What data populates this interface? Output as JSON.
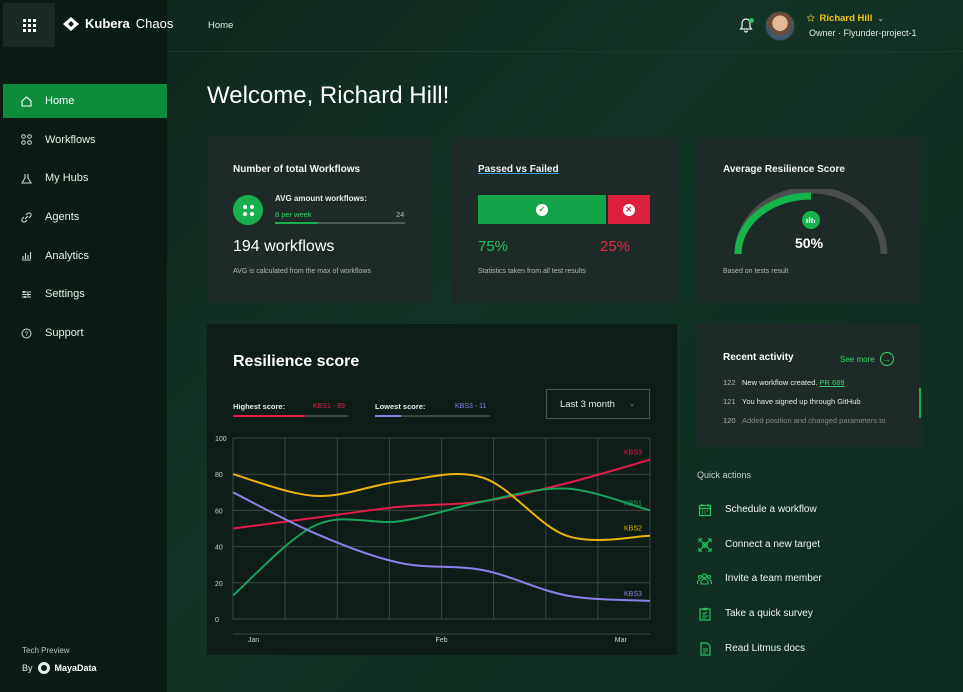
{
  "brand": {
    "name_bold": "Kubera",
    "name_light": "Chaos"
  },
  "sidebar": {
    "items": [
      {
        "label": "Home",
        "icon": "home-icon",
        "active": true
      },
      {
        "label": "Workflows",
        "icon": "workflows-icon",
        "active": false
      },
      {
        "label": "My Hubs",
        "icon": "hub-icon",
        "active": false
      },
      {
        "label": "Agents",
        "icon": "link-icon",
        "active": false
      },
      {
        "label": "Analytics",
        "icon": "analytics-icon",
        "active": false
      },
      {
        "label": "Settings",
        "icon": "settings-icon",
        "active": false
      },
      {
        "label": "Support",
        "icon": "support-icon",
        "active": false
      }
    ],
    "tech_preview": "Tech Preview",
    "by": "By",
    "maker": "MayaData"
  },
  "header": {
    "breadcrumb": "Home",
    "user_name": "Richard Hill",
    "user_role": "Owner · Flyunder-project-1"
  },
  "welcome": "Welcome, Richard Hill!",
  "total_workflows": {
    "title": "Number of total Workflows",
    "avg_label": "AVG amount workflows:",
    "per_week": "8 per week",
    "max": "24",
    "progress": 0.33,
    "count": "194 workflows",
    "note": "AVG is calculated from the max of workflows"
  },
  "passed_failed": {
    "title": "Passed vs Failed",
    "passed": "75%",
    "failed": "25%",
    "passed_fraction": 0.75,
    "note": "Statistics taken from all test results"
  },
  "resilience_avg": {
    "title": "Average Resilience Score",
    "value": "50%",
    "fraction": 0.5,
    "note": "Based on tests result"
  },
  "resilience_chart": {
    "title": "Resilience score",
    "highest_label": "Highest score:",
    "highest_value": "KBS1 - 89",
    "lowest_label": "Lowest score:",
    "lowest_value": "KBS3 - 11",
    "range": "Last 3 month"
  },
  "chart_data": {
    "type": "line",
    "x": [
      "Jan",
      "Feb",
      "Mar"
    ],
    "ylim": [
      0,
      100
    ],
    "yticks": [
      0,
      20,
      40,
      60,
      80,
      100
    ],
    "grid": true,
    "series": [
      {
        "name": "KBS3",
        "color": "#e11d48",
        "points": [
          [
            0,
            50
          ],
          [
            0.2,
            56
          ],
          [
            0.4,
            62
          ],
          [
            0.6,
            65
          ],
          [
            0.8,
            75
          ],
          [
            1,
            88
          ]
        ]
      },
      {
        "name": "KBS1",
        "color": "#16a35a",
        "points": [
          [
            0,
            13
          ],
          [
            0.2,
            52
          ],
          [
            0.4,
            54
          ],
          [
            0.6,
            65
          ],
          [
            0.8,
            72
          ],
          [
            1,
            60
          ]
        ]
      },
      {
        "name": "KBS2",
        "color": "#eab308",
        "points": [
          [
            0,
            80
          ],
          [
            0.2,
            68
          ],
          [
            0.4,
            76
          ],
          [
            0.6,
            78
          ],
          [
            0.8,
            46
          ],
          [
            1,
            46
          ]
        ]
      },
      {
        "name": "KBS3",
        "color": "#8b7fe8",
        "points": [
          [
            0,
            70
          ],
          [
            0.2,
            47
          ],
          [
            0.4,
            31
          ],
          [
            0.6,
            27
          ],
          [
            0.8,
            13
          ],
          [
            1,
            10
          ]
        ]
      }
    ]
  },
  "recent_activity": {
    "title": "Recent activity",
    "see_more": "See more",
    "items": [
      {
        "n": "122",
        "text": "New workflow created.",
        "link": "PR 689"
      },
      {
        "n": "121",
        "text": "You have signed up through GitHub",
        "link": ""
      },
      {
        "n": "120",
        "text": "Added position and changed parameters to",
        "link": ""
      }
    ]
  },
  "quick_actions": {
    "title": "Quick actions",
    "items": [
      {
        "label": "Schedule a workflow",
        "icon": "calendar-icon"
      },
      {
        "label": "Connect a new target",
        "icon": "target-icon"
      },
      {
        "label": "Invite a team member",
        "icon": "team-icon"
      },
      {
        "label": "Take a quick survey",
        "icon": "survey-icon"
      },
      {
        "label": "Read Litmus docs",
        "icon": "docs-icon"
      }
    ]
  },
  "colors": {
    "accent": "#0e8a3c",
    "pass": "#19c454",
    "fail": "#e02a45",
    "user": "#f5c518"
  }
}
